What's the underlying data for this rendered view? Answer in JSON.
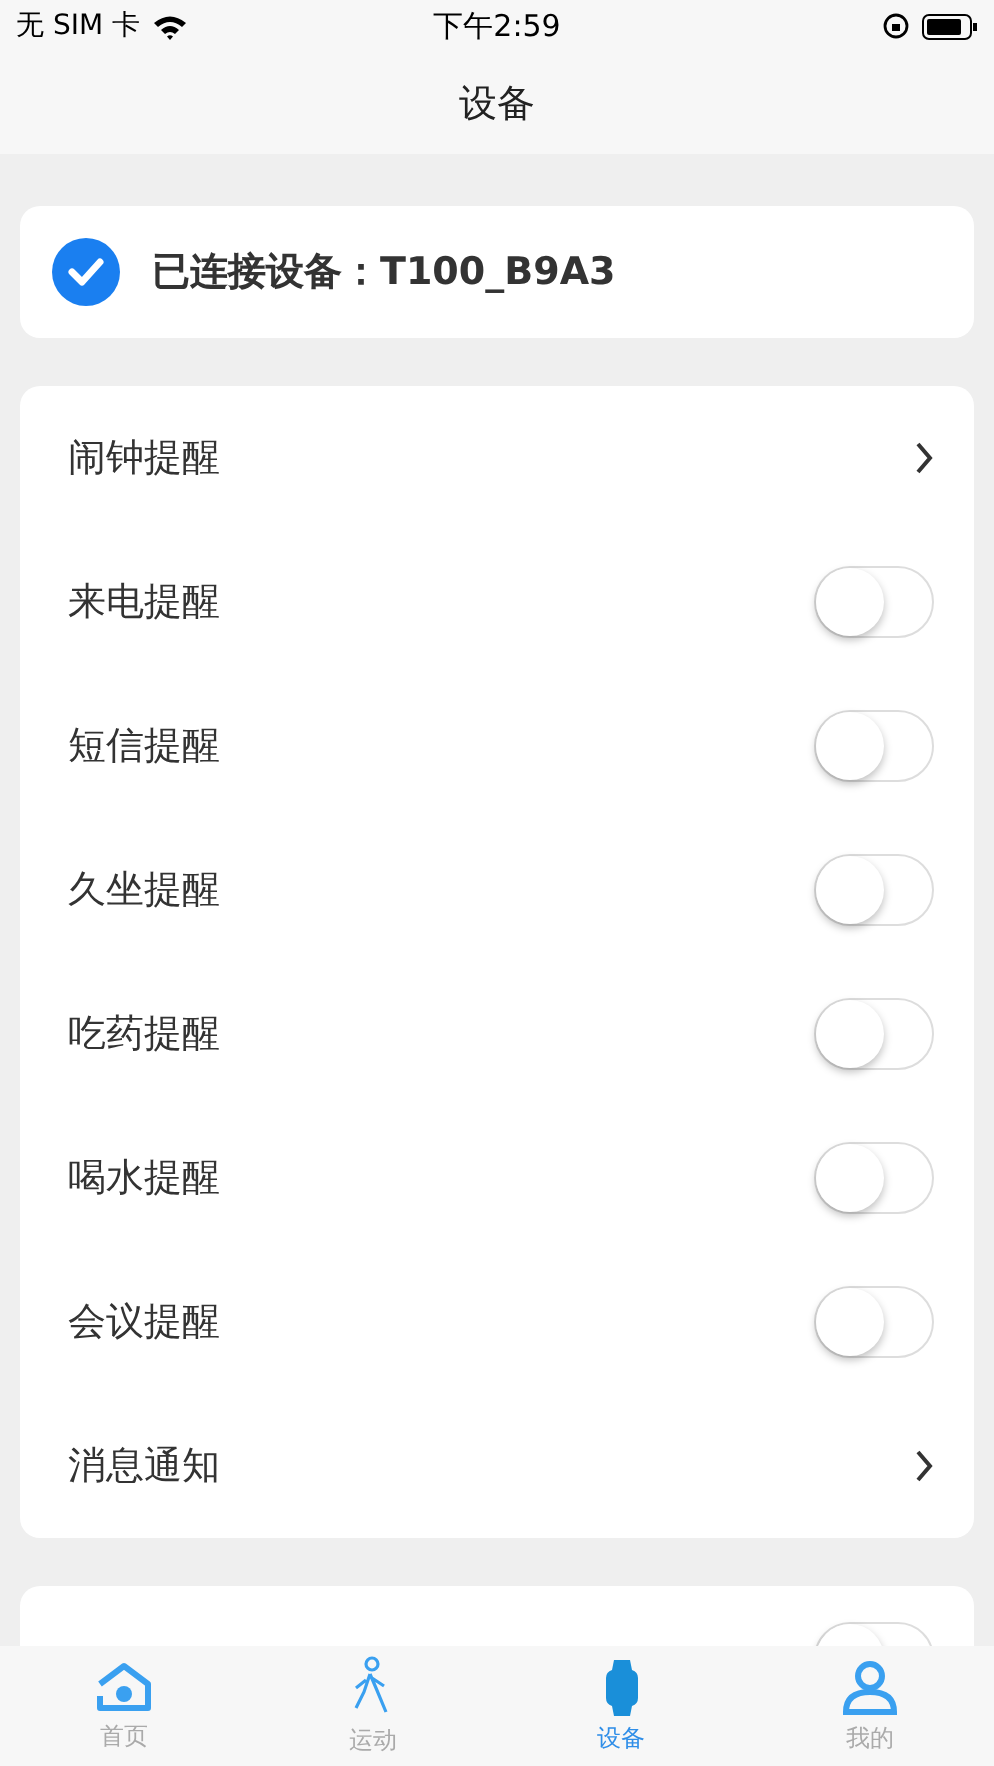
{
  "status_bar": {
    "carrier": "无 SIM 卡",
    "time": "下午2:59"
  },
  "nav_bar": {
    "title": "设备"
  },
  "device": {
    "connected": true,
    "label": "已连接设备：T100_B9A3"
  },
  "settings": [
    {
      "kind": "link",
      "label": "闹钟提醒"
    },
    {
      "kind": "switch",
      "label": "来电提醒",
      "on": false
    },
    {
      "kind": "switch",
      "label": "短信提醒",
      "on": false
    },
    {
      "kind": "switch",
      "label": "久坐提醒",
      "on": false
    },
    {
      "kind": "switch",
      "label": "吃药提醒",
      "on": false
    },
    {
      "kind": "switch",
      "label": "喝水提醒",
      "on": false
    },
    {
      "kind": "switch",
      "label": "会议提醒",
      "on": false
    },
    {
      "kind": "link",
      "label": "消息通知"
    }
  ],
  "settings_2": [
    {
      "kind": "switch",
      "on": false
    }
  ],
  "tab_bar": [
    {
      "kind": "home",
      "label": "首页",
      "selected": false
    },
    {
      "kind": "run",
      "label": "运动",
      "selected": false
    },
    {
      "kind": "watch",
      "label": "设备",
      "selected": true
    },
    {
      "kind": "user",
      "label": "我的",
      "selected": false
    }
  ]
}
